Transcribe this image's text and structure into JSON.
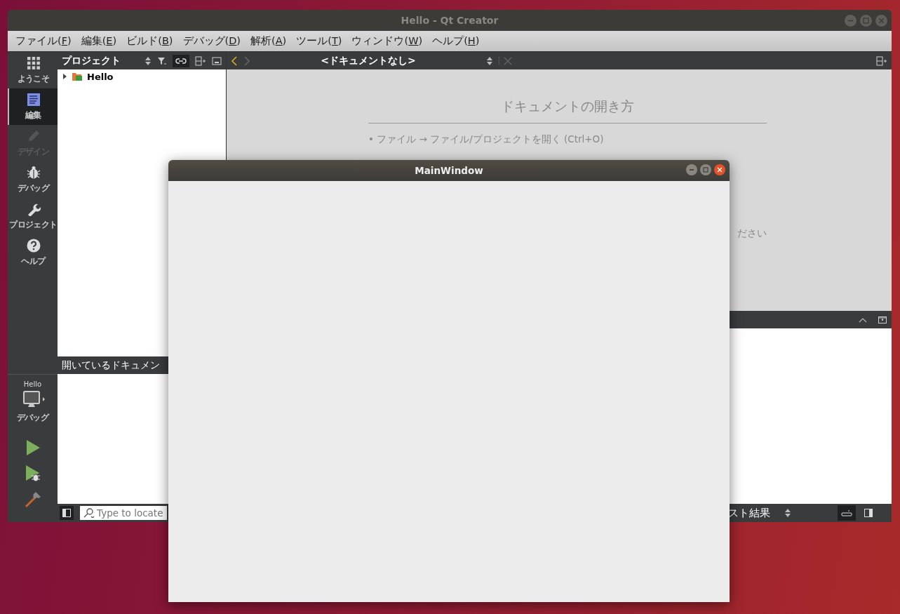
{
  "qt_creator": {
    "title": "Hello - Qt Creator",
    "menu": [
      {
        "before": "ファイル(",
        "key": "F",
        "after": ")"
      },
      {
        "before": "編集(",
        "key": "E",
        "after": ")"
      },
      {
        "before": "ビルド(",
        "key": "B",
        "after": ")"
      },
      {
        "before": "デバッグ(",
        "key": "D",
        "after": ")"
      },
      {
        "before": "解析(",
        "key": "A",
        "after": ")"
      },
      {
        "before": "ツール(",
        "key": "T",
        "after": ")"
      },
      {
        "before": "ウィンドウ(",
        "key": "W",
        "after": ")"
      },
      {
        "before": "ヘルプ(",
        "key": "H",
        "after": ")"
      }
    ],
    "modes": [
      {
        "kind": "welcome",
        "label": "ようこそ",
        "selected": false,
        "disabled": false
      },
      {
        "kind": "edit",
        "label": "編集",
        "selected": true,
        "disabled": false
      },
      {
        "kind": "design",
        "label": "デザイン",
        "selected": false,
        "disabled": true
      },
      {
        "kind": "debug",
        "label": "デバッグ",
        "selected": false,
        "disabled": false
      },
      {
        "kind": "projects",
        "label": "プロジェクト",
        "selected": false,
        "disabled": false
      },
      {
        "kind": "help",
        "label": "ヘルプ",
        "selected": false,
        "disabled": false
      }
    ],
    "kit": {
      "project": "Hello",
      "build": "デバッグ"
    },
    "project_panel": {
      "title": "プロジェクト",
      "tree": [
        {
          "label": "Hello",
          "expanded": false
        }
      ]
    },
    "editor_toolbar": {
      "document": "<ドキュメントなし>"
    },
    "welcome": {
      "heading": "ドキュメントの開き方",
      "lines": [
        "• ファイル → ファイル/プロジェクトを開く (Ctrl+O)"
      ],
      "trailing": "ださい"
    },
    "open_documents": {
      "title": "開いているドキュメン"
    },
    "locator": {
      "placeholder": "Type to locate"
    },
    "output_selector": "スト結果"
  },
  "main_window": {
    "title": "MainWindow"
  }
}
